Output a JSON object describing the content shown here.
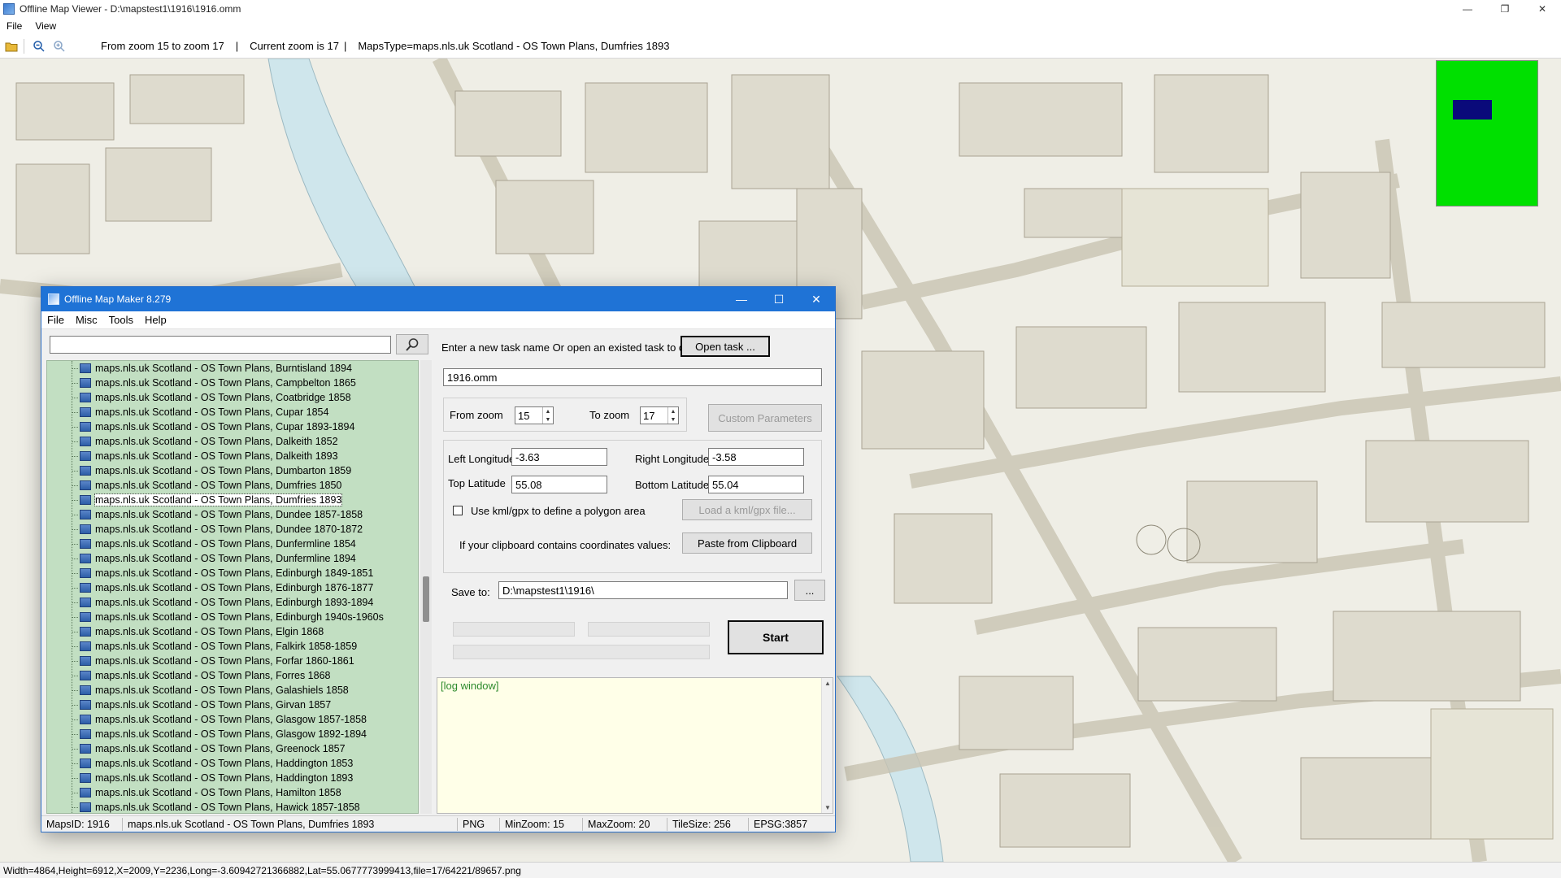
{
  "viewer": {
    "title": "Offline Map Viewer - D:\\mapstest1\\1916\\1916.omm",
    "menu": [
      "File",
      "View"
    ],
    "toolbar": {
      "zoom_range_text": "From zoom 15 to zoom 17",
      "current_zoom_text": "Current zoom is 17",
      "maps_type_text": "MapsType=maps.nls.uk Scotland - OS Town Plans, Dumfries 1893"
    },
    "minimap": {
      "bg_color": "#00e000",
      "view_color": "#0a0a7a"
    },
    "status_bar": "Width=4864,Height=6912,X=2009,Y=2236,Long=-3.60942721366882,Lat=55.0677773999413,file=17/64221/89657.png"
  },
  "dialog": {
    "title": "Offline Map Maker 8.279",
    "menu": [
      "File",
      "Misc",
      "Tools",
      "Help"
    ],
    "search": {
      "value": "",
      "placeholder": ""
    },
    "tree_items": [
      "maps.nls.uk Scotland - OS Town Plans, Burntisland 1894",
      "maps.nls.uk Scotland - OS Town Plans, Campbelton 1865",
      "maps.nls.uk Scotland - OS Town Plans, Coatbridge 1858",
      "maps.nls.uk Scotland - OS Town Plans, Cupar 1854",
      "maps.nls.uk Scotland - OS Town Plans, Cupar 1893-1894",
      "maps.nls.uk Scotland - OS Town Plans, Dalkeith 1852",
      "maps.nls.uk Scotland - OS Town Plans, Dalkeith 1893",
      "maps.nls.uk Scotland - OS Town Plans, Dumbarton 1859",
      "maps.nls.uk Scotland - OS Town Plans, Dumfries 1850",
      "maps.nls.uk Scotland - OS Town Plans, Dumfries 1893",
      "maps.nls.uk Scotland - OS Town Plans, Dundee 1857-1858",
      "maps.nls.uk Scotland - OS Town Plans, Dundee 1870-1872",
      "maps.nls.uk Scotland - OS Town Plans, Dunfermline 1854",
      "maps.nls.uk Scotland - OS Town Plans, Dunfermline 1894",
      "maps.nls.uk Scotland - OS Town Plans, Edinburgh 1849-1851",
      "maps.nls.uk Scotland - OS Town Plans, Edinburgh 1876-1877",
      "maps.nls.uk Scotland - OS Town Plans, Edinburgh 1893-1894",
      "maps.nls.uk Scotland - OS Town Plans, Edinburgh 1940s-1960s",
      "maps.nls.uk Scotland - OS Town Plans, Elgin 1868",
      "maps.nls.uk Scotland - OS Town Plans, Falkirk 1858-1859",
      "maps.nls.uk Scotland - OS Town Plans, Forfar 1860-1861",
      "maps.nls.uk Scotland - OS Town Plans, Forres 1868",
      "maps.nls.uk Scotland - OS Town Plans, Galashiels 1858",
      "maps.nls.uk Scotland - OS Town Plans, Girvan 1857",
      "maps.nls.uk Scotland - OS Town Plans, Glasgow 1857-1858",
      "maps.nls.uk Scotland - OS Town Plans, Glasgow 1892-1894",
      "maps.nls.uk Scotland - OS Town Plans, Greenock 1857",
      "maps.nls.uk Scotland - OS Town Plans, Haddington 1853",
      "maps.nls.uk Scotland - OS Town Plans, Haddington 1893",
      "maps.nls.uk Scotland - OS Town Plans, Hamilton 1858",
      "maps.nls.uk Scotland - OS Town Plans, Hawick 1857-1858"
    ],
    "selected_index": 9,
    "task_prompt": "Enter a new task name Or open an existed task to continue:",
    "open_task_label": "Open task ...",
    "task_name": "1916.omm",
    "from_zoom_label": "From zoom",
    "from_zoom": "15",
    "to_zoom_label": "To zoom",
    "to_zoom": "17",
    "custom_params_label": "Custom Parameters",
    "left_lon_label": "Left Longitude",
    "left_lon": "-3.63",
    "right_lon_label": "Right Longitude",
    "right_lon": "-3.58",
    "top_lat_label": "Top Latitude",
    "top_lat": "55.08",
    "bottom_lat_label": "Bottom Latitude",
    "bottom_lat": "55.04",
    "use_kml_label": "Use kml/gpx to define a polygon area",
    "use_kml_checked": false,
    "load_kml_label": "Load a kml/gpx file...",
    "clipboard_prompt": "If your clipboard contains coordinates values:",
    "paste_label": "Paste from Clipboard",
    "save_to_label": "Save to:",
    "save_to": "D:\\mapstest1\\1916\\",
    "browse_label": "...",
    "start_label": "Start",
    "log_text": "[log window]",
    "status": {
      "maps_id": "MapsID: 1916",
      "name": "maps.nls.uk Scotland - OS Town Plans, Dumfries 1893",
      "format": "PNG",
      "min_zoom": "MinZoom: 15",
      "max_zoom": "MaxZoom: 20",
      "tile_size": "TileSize: 256",
      "epsg": "EPSG:3857"
    }
  }
}
